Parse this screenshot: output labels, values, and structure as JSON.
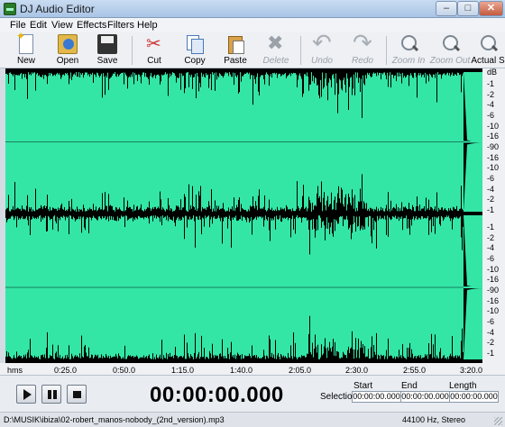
{
  "window": {
    "title": "DJ Audio Editor"
  },
  "menu": [
    "File",
    "Edit",
    "View",
    "Effects",
    "Filters",
    "Help"
  ],
  "toolbar": {
    "new": "New",
    "open": "Open",
    "save": "Save",
    "cut": "Cut",
    "copy": "Copy",
    "paste": "Paste",
    "delete": "Delete",
    "undo": "Undo",
    "redo": "Redo",
    "zoom_in": "Zoom In",
    "zoom_out": "Zoom Out",
    "actual_size": "Actual S"
  },
  "db_scale": {
    "unit": "dB",
    "channel_labels": [
      "-1",
      "-2",
      "-4",
      "-6",
      "-10",
      "-16",
      "-90",
      "-16",
      "-10",
      "-6",
      "-4",
      "-2",
      "-1"
    ]
  },
  "ruler": {
    "unit": "hms",
    "ticks": [
      "0:25.0",
      "0:50.0",
      "1:15.0",
      "1:40.0",
      "2:05.0",
      "2:30.0",
      "2:55.0",
      "3:20.0"
    ]
  },
  "transport": {
    "time": "00:00:00.000",
    "selection_label": "Selection",
    "start_label": "Start",
    "end_label": "End",
    "length_label": "Length",
    "start": "00:00:00.000",
    "end": "00:00:00.000",
    "length": "00:00:00.000"
  },
  "status": {
    "path": "D:\\MUSIK\\ibiza\\02-robert_manos-nobody_(2nd_version).mp3",
    "format": "44100 Hz, Stereo"
  },
  "colors": {
    "waveform": "#33e6a6",
    "background": "#000000"
  }
}
